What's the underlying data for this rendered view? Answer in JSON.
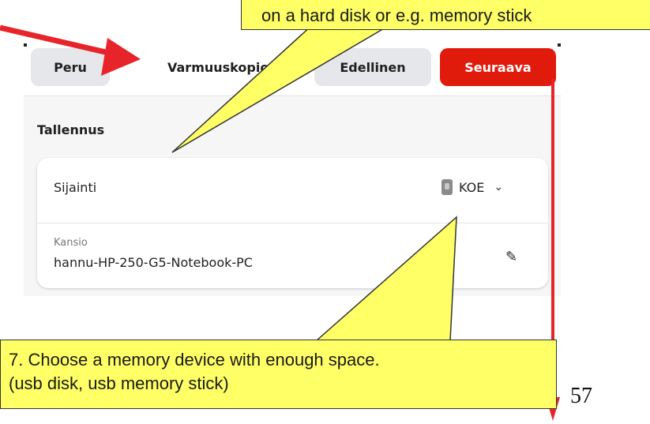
{
  "toolbar": {
    "cancel_label": "Peru",
    "title": "Varmuuskopio",
    "previous_label": "Edellinen",
    "next_label": "Seuraava"
  },
  "section": {
    "title": "Tallennus"
  },
  "location": {
    "label": "Sijainti",
    "value": "KOE",
    "icon": "drive-icon"
  },
  "folder": {
    "caption": "Kansio",
    "value": "hannu-HP-250-G5-Notebook-PC",
    "icon": "edit-icon"
  },
  "annotations": {
    "top_callout": "on a hard disk or e.g. memory stick",
    "bottom_line1": "7. Choose a memory device with enough space.",
    "bottom_line2": "(usb disk, usb memory stick)",
    "page_number": "57"
  },
  "colors": {
    "accent_red": "#e01b0c",
    "callout_yellow": "#ffff66",
    "arrow_red": "#e8242b"
  }
}
